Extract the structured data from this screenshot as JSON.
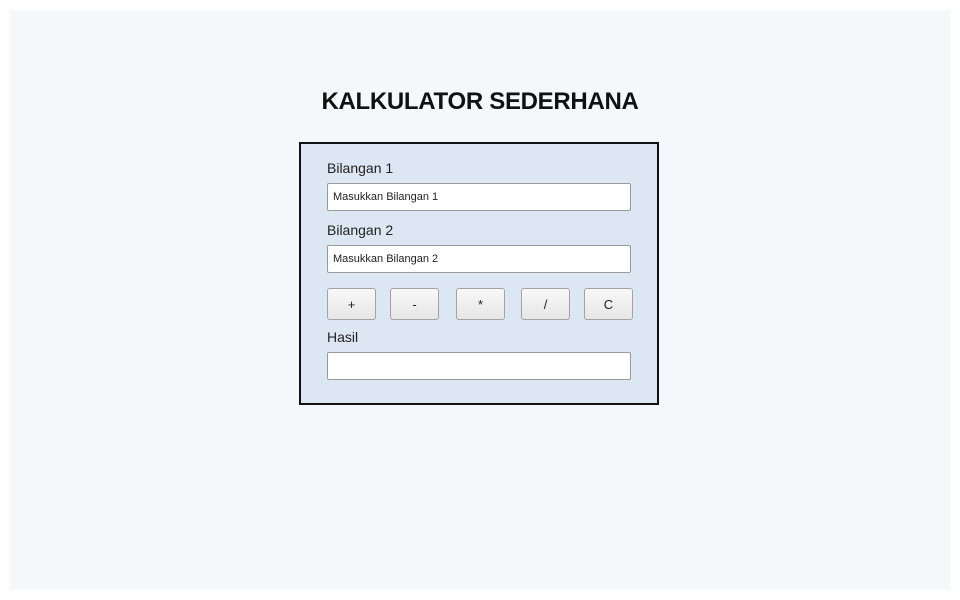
{
  "title": "KALKULATOR SEDERHANA",
  "form": {
    "bilangan1": {
      "label": "Bilangan 1",
      "placeholder": "Masukkan Bilangan 1",
      "value": ""
    },
    "bilangan2": {
      "label": "Bilangan 2",
      "placeholder": "Masukkan Bilangan 2",
      "value": ""
    },
    "operators": {
      "add": "+",
      "subtract": "-",
      "multiply": "*",
      "divide": "/",
      "clear": "C"
    },
    "hasil": {
      "label": "Hasil",
      "value": ""
    }
  }
}
